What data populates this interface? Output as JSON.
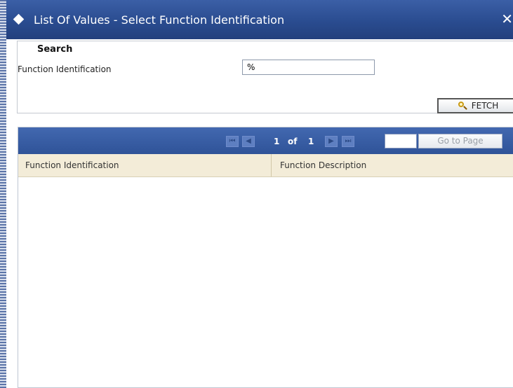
{
  "window": {
    "title": "List Of Values - Select Function Identification",
    "close_symbol": "✕",
    "title_icon": "diamond-icon"
  },
  "search": {
    "legend": "Search",
    "field_label": "Function Identification",
    "field_value": "%",
    "fetch_label": "FETCH",
    "fetch_icon": "magnifier-icon"
  },
  "grid": {
    "pagination": {
      "current_page": "1",
      "of_label": "of",
      "total_pages": "1",
      "goto_label": "Go to Page"
    },
    "columns": [
      {
        "label": "Function Identification"
      },
      {
        "label": "Function Description"
      }
    ],
    "rows": []
  },
  "colors": {
    "titlebar": "#2a4c90",
    "toolbar": "#3a5fa6",
    "header_bg": "#f3ecd8"
  }
}
